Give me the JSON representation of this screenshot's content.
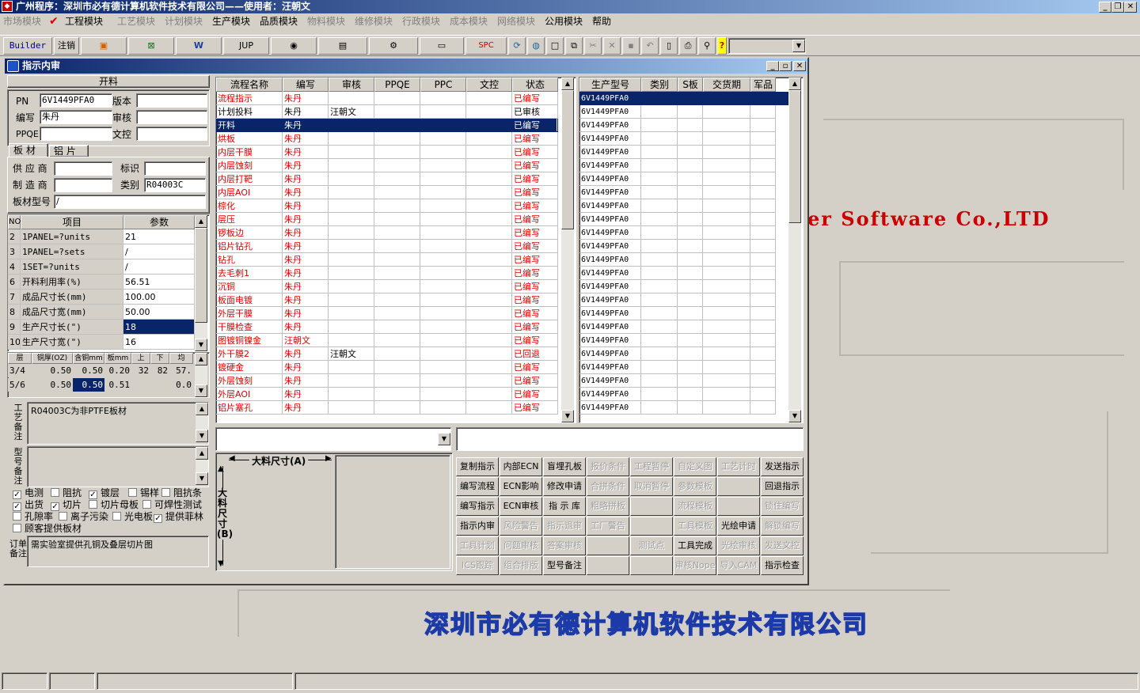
{
  "app": {
    "title": "广州程序：深圳市必有德计算机软件技术有限公司——使用者：汪朝文"
  },
  "menu": [
    {
      "label": "市场模块",
      "enabled": false
    },
    {
      "label": "工程模块",
      "enabled": true
    },
    {
      "label": "工艺模块",
      "enabled": false
    },
    {
      "label": "计划模块",
      "enabled": false
    },
    {
      "label": "生产模块",
      "enabled": true
    },
    {
      "label": "品质模块",
      "enabled": true
    },
    {
      "label": "物料模块",
      "enabled": false
    },
    {
      "label": "维修模块",
      "enabled": false
    },
    {
      "label": "行政模块",
      "enabled": false
    },
    {
      "label": "成本模块",
      "enabled": false
    },
    {
      "label": "网络模块",
      "enabled": false
    },
    {
      "label": "公用模块",
      "enabled": true
    },
    {
      "label": "帮助",
      "enabled": true
    }
  ],
  "toolbar": {
    "builder": "Builder",
    "logout": "注销",
    "jup": "JUP",
    "spc": "SPC",
    "help_q": "?"
  },
  "background": {
    "english": "er Software Co.,LTD",
    "chinese": "深圳市必有德计算机软件技术有限公司"
  },
  "window": {
    "title": "指示内审"
  },
  "left": {
    "section_title": "开料",
    "pn_label": "PN",
    "pn_value": "6V1449PFA0",
    "version_label": "版本",
    "version_value": "",
    "author_label": "编写",
    "author_value": "朱丹",
    "review_label": "审核",
    "review_value": "",
    "ppqe_label": "PPQE",
    "ppqe_value": "",
    "doc_label": "文控",
    "doc_value": "",
    "tab1": "板 材",
    "tab2": "铝 片",
    "supplier_label": "供 应 商",
    "supplier_value": "",
    "mark_label": "标识",
    "mark_value": "",
    "maker_label": "制 造 商",
    "maker_value": "",
    "category_label": "类别",
    "category_value": "R04003C",
    "model_label": "板材型号",
    "model_value": "/",
    "param_headers": [
      "NO",
      "项目",
      "参数"
    ],
    "params": [
      {
        "no": "2",
        "item": "1PANEL=?units",
        "val": "21"
      },
      {
        "no": "3",
        "item": "1PANEL=?sets",
        "val": "/"
      },
      {
        "no": "4",
        "item": "1SET=?units",
        "val": "/"
      },
      {
        "no": "6",
        "item": "开料利用率(%)",
        "val": "56.51"
      },
      {
        "no": "7",
        "item": "成品尺寸长(mm)",
        "val": "100.00"
      },
      {
        "no": "8",
        "item": "成品尺寸宽(mm)",
        "val": "50.00"
      },
      {
        "no": "9",
        "item": "生产尺寸长(\")",
        "val": "18"
      },
      {
        "no": "10",
        "item": "生产尺寸宽(\")",
        "val": "16"
      }
    ],
    "layer_headers": [
      "层",
      "铜厚(OZ)",
      "含铜mm",
      "板mm",
      "上",
      "下",
      "均"
    ],
    "layers": [
      {
        "c1": "3/4",
        "c2": "0.50",
        "c3": "0.50",
        "c4": "0.20",
        "c5": "32",
        "c6": "82",
        "c7": "57."
      },
      {
        "c1": "5/6",
        "c2": "0.50",
        "c3": "0.50",
        "c4": "0.51",
        "c5": "",
        "c6": "",
        "c7": "0.0"
      }
    ],
    "process_note_label": "工艺备注",
    "process_note": "R04003C为非PTFE板材",
    "type_note_label": "型号备注",
    "type_note": "",
    "checks": [
      {
        "label": "电测",
        "checked": true
      },
      {
        "label": "阻抗",
        "checked": false
      },
      {
        "label": "镀层",
        "checked": true
      },
      {
        "label": "锡样",
        "checked": false
      },
      {
        "label": "阻抗条",
        "checked": false
      },
      {
        "label": "出货",
        "checked": true
      },
      {
        "label": "切片",
        "checked": true
      },
      {
        "label": "切片母板",
        "checked": false
      },
      {
        "label": "可焊性测试",
        "checked": false
      },
      {
        "label": "孔隙率",
        "checked": false
      },
      {
        "label": "离子污染",
        "checked": false
      },
      {
        "label": "光电板",
        "checked": false
      },
      {
        "label": "提供菲林",
        "checked": true
      },
      {
        "label": "顾客提供板材",
        "checked": false
      }
    ],
    "order_note_label": "订单备注",
    "order_note": "需实验室提供孔铜及叠层切片图"
  },
  "flow": {
    "headers": [
      "流程名称",
      "编写",
      "审核",
      "PPQE",
      "PPC",
      "文控",
      "状态"
    ],
    "rows": [
      {
        "name": "流程指示",
        "author": "朱丹",
        "review": "",
        "status": "已编写",
        "red": true
      },
      {
        "name": "计划投料",
        "author": "朱丹",
        "review": "汪朝文",
        "status": "已审核",
        "red": false
      },
      {
        "name": "开料",
        "author": "朱丹",
        "review": "",
        "status": "已编写",
        "red": true,
        "selected": true
      },
      {
        "name": "烘板",
        "author": "朱丹",
        "review": "",
        "status": "已编写",
        "red": true
      },
      {
        "name": "内层干膜",
        "author": "朱丹",
        "review": "",
        "status": "已编写",
        "red": true
      },
      {
        "name": "内层蚀刻",
        "author": "朱丹",
        "review": "",
        "status": "已编写",
        "red": true
      },
      {
        "name": "内层打靶",
        "author": "朱丹",
        "review": "",
        "status": "已编写",
        "red": true
      },
      {
        "name": "内层AOI",
        "author": "朱丹",
        "review": "",
        "status": "已编写",
        "red": true
      },
      {
        "name": "棕化",
        "author": "朱丹",
        "review": "",
        "status": "已编写",
        "red": true
      },
      {
        "name": "层压",
        "author": "朱丹",
        "review": "",
        "status": "已编写",
        "red": true
      },
      {
        "name": "锣板边",
        "author": "朱丹",
        "review": "",
        "status": "已编写",
        "red": true
      },
      {
        "name": "铝片钻孔",
        "author": "朱丹",
        "review": "",
        "status": "已编写",
        "red": true
      },
      {
        "name": "钻孔",
        "author": "朱丹",
        "review": "",
        "status": "已编写",
        "red": true
      },
      {
        "name": "去毛刺1",
        "author": "朱丹",
        "review": "",
        "status": "已编写",
        "red": true
      },
      {
        "name": "沉铜",
        "author": "朱丹",
        "review": "",
        "status": "已编写",
        "red": true
      },
      {
        "name": "板面电镀",
        "author": "朱丹",
        "review": "",
        "status": "已编写",
        "red": true
      },
      {
        "name": "外层干膜",
        "author": "朱丹",
        "review": "",
        "status": "已编写",
        "red": true
      },
      {
        "name": "干膜检查",
        "author": "朱丹",
        "review": "",
        "status": "已编写",
        "red": true
      },
      {
        "name": "图镀铜镍金",
        "author": "汪朝文",
        "review": "",
        "status": "已编写",
        "red": true
      },
      {
        "name": "外干膜2",
        "author": "朱丹",
        "review": "汪朝文",
        "status": "已回退",
        "red": true
      },
      {
        "name": "镀硬金",
        "author": "朱丹",
        "review": "",
        "status": "已编写",
        "red": true
      },
      {
        "name": "外层蚀刻",
        "author": "朱丹",
        "review": "",
        "status": "已编写",
        "red": true
      },
      {
        "name": "外层AOI",
        "author": "朱丹",
        "review": "",
        "status": "已编写",
        "red": true
      },
      {
        "name": "铝片塞孔",
        "author": "朱丹",
        "review": "",
        "status": "已编写",
        "red": true
      }
    ]
  },
  "models": {
    "headers": [
      "生产型号",
      "类别",
      "S板",
      "交货期",
      "军品"
    ],
    "rows": [
      "6V1449PFA0",
      "6V1449PFA0",
      "6V1449PFA0",
      "6V1449PFA0",
      "6V1449PFA0",
      "6V1449PFA0",
      "6V1449PFA0",
      "6V1449PFA0",
      "6V1449PFA0",
      "6V1449PFA0",
      "6V1449PFA0",
      "6V1449PFA0",
      "6V1449PFA0",
      "6V1449PFA0",
      "6V1449PFA0",
      "6V1449PFA0",
      "6V1449PFA0",
      "6V1449PFA0",
      "6V1449PFA0",
      "6V1449PFA0",
      "6V1449PFA0",
      "6V1449PFA0",
      "6V1449PFA0",
      "6V1449PFA0"
    ]
  },
  "material": {
    "size_a": "大料尺寸(A)",
    "size_b": "大料尺寸(B)"
  },
  "buttons": [
    [
      {
        "l": "复制指示",
        "e": true
      },
      {
        "l": "内部ECN",
        "e": true
      },
      {
        "l": "盲埋孔板",
        "e": true
      },
      {
        "l": "报价条件",
        "e": false
      },
      {
        "l": "工程暂停",
        "e": false
      },
      {
        "l": "自定义图",
        "e": false
      },
      {
        "l": "工艺计时",
        "e": false
      },
      {
        "l": "发送指示",
        "e": true
      }
    ],
    [
      {
        "l": "编写流程",
        "e": true
      },
      {
        "l": "ECN影响",
        "e": true
      },
      {
        "l": "修改申请",
        "e": true
      },
      {
        "l": "合拼条件",
        "e": false
      },
      {
        "l": "取消暂停",
        "e": false
      },
      {
        "l": "参数模板",
        "e": false
      },
      {
        "l": "",
        "e": false
      },
      {
        "l": "回退指示",
        "e": true
      }
    ],
    [
      {
        "l": "编写指示",
        "e": true
      },
      {
        "l": "ECN审核",
        "e": true
      },
      {
        "l": "指 示 库",
        "e": true
      },
      {
        "l": "粗略拼板",
        "e": false
      },
      {
        "l": "",
        "e": false
      },
      {
        "l": "流程模板",
        "e": false
      },
      {
        "l": "",
        "e": false
      },
      {
        "l": "锁住编写",
        "e": false
      }
    ],
    [
      {
        "l": "指示内审",
        "e": true
      },
      {
        "l": "风险警告",
        "e": false
      },
      {
        "l": "指示退审",
        "e": false
      },
      {
        "l": "工厂警告",
        "e": false
      },
      {
        "l": "",
        "e": false
      },
      {
        "l": "工具模板",
        "e": false
      },
      {
        "l": "光绘申请",
        "e": true
      },
      {
        "l": "解锁编写",
        "e": false
      }
    ],
    [
      {
        "l": "工具计划",
        "e": false
      },
      {
        "l": "问题审核",
        "e": false
      },
      {
        "l": "答案审核",
        "e": false
      },
      {
        "l": "",
        "e": false
      },
      {
        "l": "测试点",
        "e": false
      },
      {
        "l": "工具完成",
        "e": true
      },
      {
        "l": "光绘审核",
        "e": false
      },
      {
        "l": "发送文控",
        "e": false
      }
    ],
    [
      {
        "l": "ICS跟踪",
        "e": false
      },
      {
        "l": "组合排版",
        "e": false
      },
      {
        "l": "型号备注",
        "e": true
      },
      {
        "l": "",
        "e": false
      },
      {
        "l": "",
        "e": false
      },
      {
        "l": "审核Nope",
        "e": false
      },
      {
        "l": "导入CAM",
        "e": false
      },
      {
        "l": "指示检查",
        "e": true
      }
    ]
  ]
}
